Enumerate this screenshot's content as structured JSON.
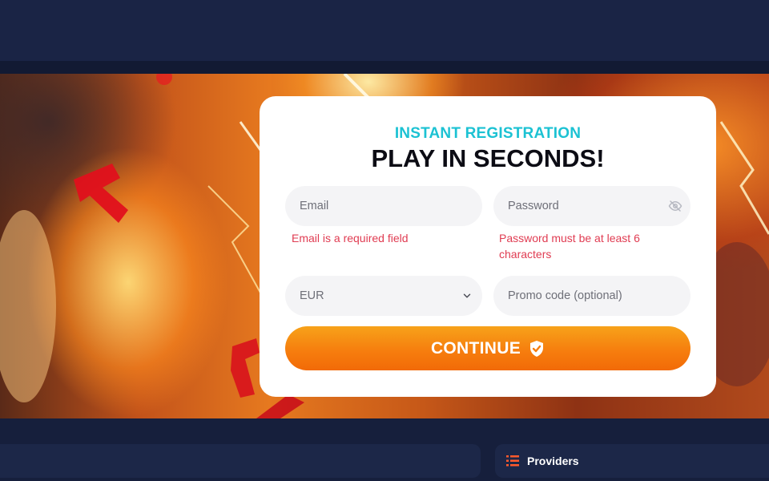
{
  "registration": {
    "subtitle": "INSTANT REGISTRATION",
    "title": "PLAY IN SECONDS!",
    "email": {
      "placeholder": "Email",
      "value": "",
      "error": "Email is a required field"
    },
    "password": {
      "placeholder": "Password",
      "value": "",
      "error": "Password must be at least 6 characters",
      "toggle_icon": "eye-off-icon"
    },
    "currency": {
      "selected": "EUR",
      "icon": "chevron-down-icon"
    },
    "promo": {
      "placeholder": "Promo code (optional)",
      "value": ""
    },
    "submit": {
      "label": "CONTINUE",
      "icon": "shield-check-icon"
    }
  },
  "providers_panel": {
    "label": "Providers",
    "icon": "list-icon"
  },
  "colors": {
    "accent_cyan": "#1cc2d3",
    "error_red": "#e03c52",
    "cta_orange": "#f67e0e",
    "page_navy": "#161f3c"
  }
}
